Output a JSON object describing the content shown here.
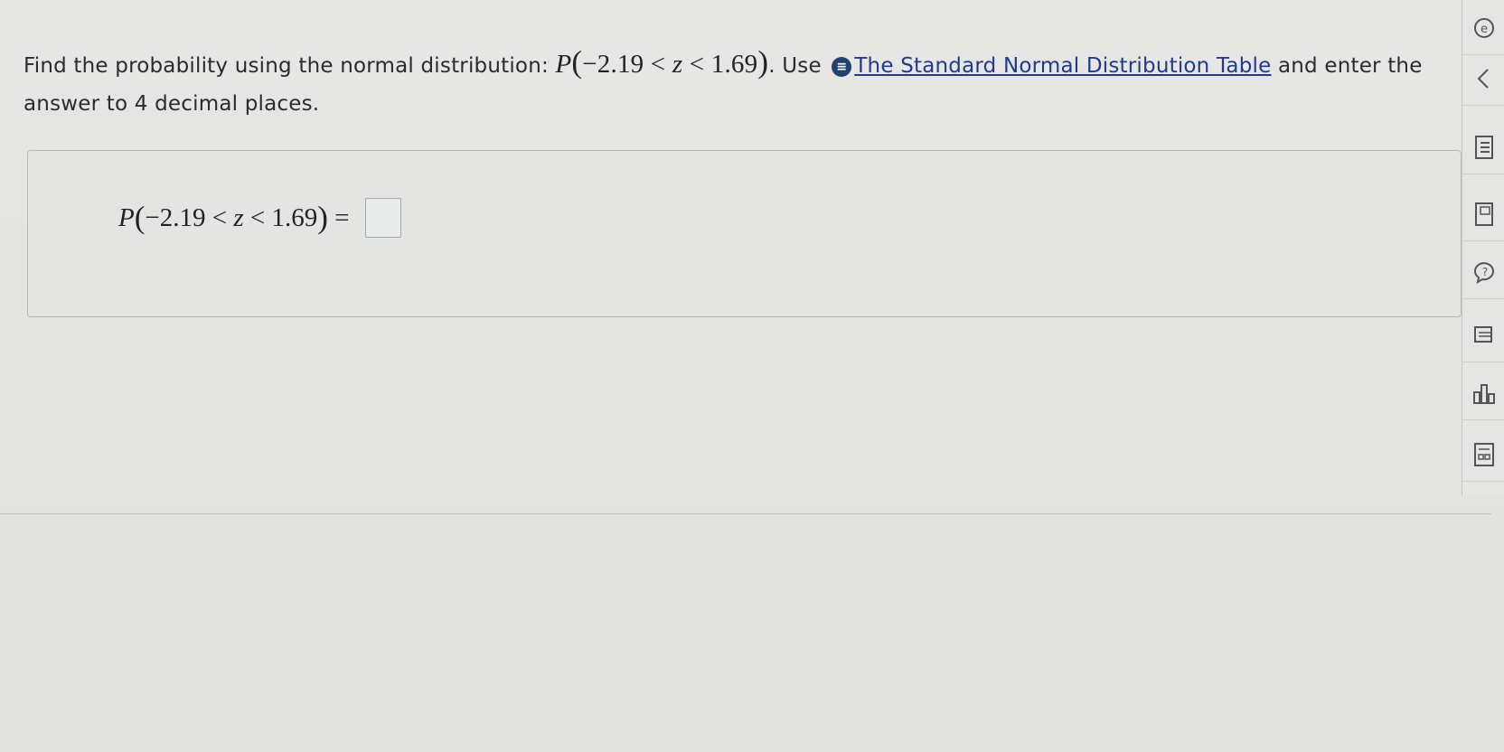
{
  "question": {
    "intro": "Find the probability using the normal distribution: ",
    "math": {
      "p": "P",
      "open": "(",
      "lower": "−2.19",
      "lt1": " < ",
      "var": "z",
      "lt2": " < ",
      "upper": "1.69",
      "close": ")"
    },
    "period_use": ". Use ",
    "info_icon_glyph": "≡",
    "link_text": "The Standard Normal Distribution Table",
    "rest": " and enter the answer to 4 decimal places."
  },
  "answer": {
    "p": "P",
    "open": "(",
    "lower": "−2.19",
    "lt1": " < ",
    "var": "z",
    "lt2": " < ",
    "upper": "1.69",
    "close": ")",
    "equals": " = ",
    "input_value": ""
  },
  "toolbar": {
    "items": [
      {
        "icon": "circle-e-icon"
      },
      {
        "icon": "chevron-left-icon"
      },
      {
        "icon": "list-icon"
      },
      {
        "icon": "textbook-icon"
      },
      {
        "icon": "help-icon"
      },
      {
        "icon": "print-icon"
      },
      {
        "icon": "bar-chart-icon"
      },
      {
        "icon": "calculator-icon"
      }
    ]
  }
}
